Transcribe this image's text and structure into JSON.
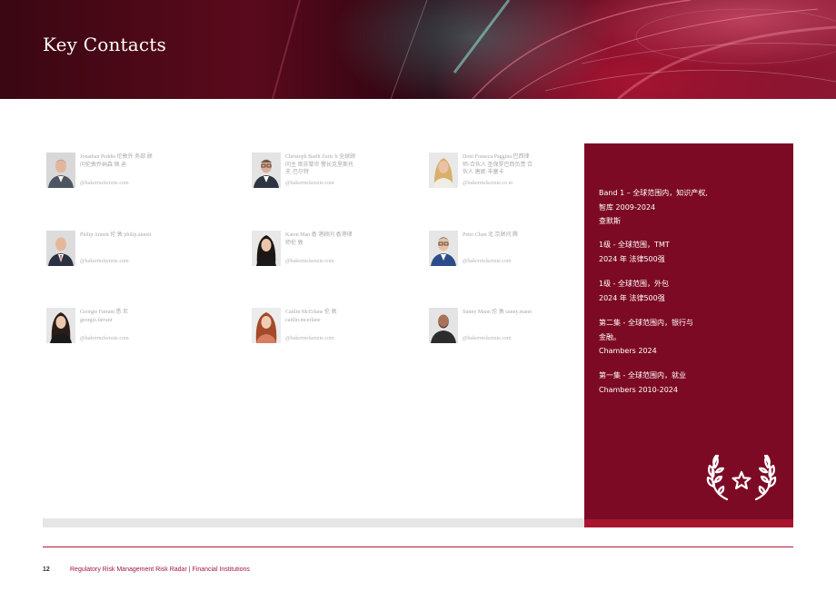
{
  "header": {
    "title": "Key Contacts"
  },
  "contacts": [
    {
      "name": "Jonathan Peddie 伦敦外 务部 顾问伦敦乔纳森 佩 迪",
      "email": "@bakermckenzie.com",
      "photo": "man-gray-suit-icon"
    },
    {
      "name": "Christoph Barth Zuric h 全球顾问主 席苏黎世 警长克里斯托夫·巴尔特",
      "email": "@bakermckenzie.com",
      "photo": "man-glasses-icon"
    },
    {
      "name": "Doni Fonseca Paggina 巴西律 师-合伙人 圣保罗巴西负责 合伙人 唐妮·丰塞卡",
      "email": "@bakermckenzie.co m",
      "photo": "woman-blonde-icon"
    },
    {
      "name": "Philip Annett 伦 敦 philip.annett",
      "email": "@bakermckenzie.com",
      "photo": "man-suit-icon"
    },
    {
      "name": "Karen Man 香 港顾问 香港律 师伦 敦",
      "email": "@bakermckenzie.com",
      "photo": "woman-dark-hair-icon"
    },
    {
      "name": "Peter Chan 北 京顾问 腾",
      "email": "@bakermckenzie.com",
      "photo": "man-glasses-blue-icon"
    },
    {
      "name": "Georgie Farrant 悉 尼 georgie.farrant",
      "email": "@bakermckenzie.com",
      "photo": "woman-dark-long-hair-icon"
    },
    {
      "name": "Caitlin McErlane 伦 敦 caitlin.mcerlane",
      "email": "@bakermckenzie.com",
      "photo": "woman-red-hair-icon"
    },
    {
      "name": "Sunny Mann 伦 敦 sunny.mann",
      "email": "@bakermckenzie.com",
      "photo": "man-beard-icon"
    }
  ],
  "awards": [
    {
      "lines": [
        "Band 1 – 全球范围内，知识产权,",
        "智库 2009-2024",
        "查默斯"
      ]
    },
    {
      "lines": [
        "1级 - 全球范围，TMT",
        "2024 年 法律500强"
      ]
    },
    {
      "lines": [
        "1级 - 全球范围，外包",
        "2024 年 法律500强"
      ]
    },
    {
      "lines": [
        "第二集 - 全球范围内，银行与",
        "金融。",
        "Chambers 2024"
      ]
    },
    {
      "lines": [
        "第一集 - 全球范围内，就业",
        "Chambers 2010-2024"
      ]
    }
  ],
  "award_icon": "laurel-star-icon",
  "footer": {
    "page_number": "12",
    "text": "Regulatory Risk Management Risk Radar | Financial Institutions"
  },
  "colors": {
    "panel": "#7d0a24",
    "accent": "#b01a3a",
    "footer_text": "#a1173a"
  }
}
